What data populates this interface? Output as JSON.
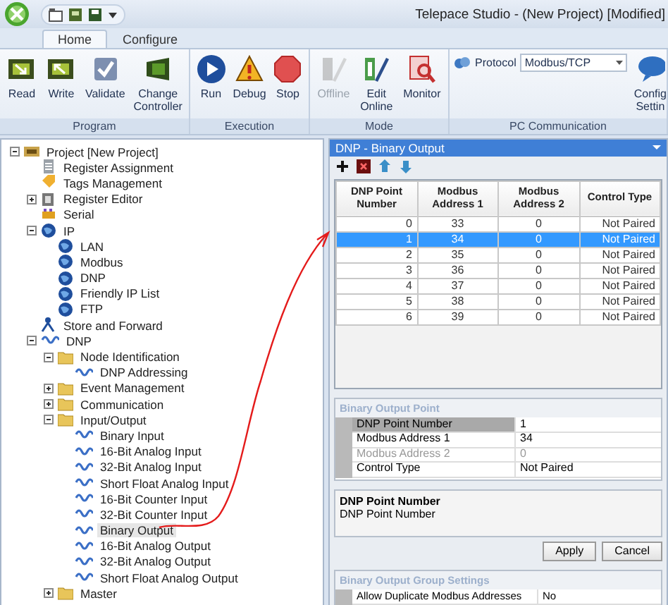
{
  "window": {
    "title": "Telepace Studio - (New Project) [Modified]"
  },
  "ribbon": {
    "tabs": [
      {
        "label": "Home",
        "selected": true
      },
      {
        "label": "Configure",
        "selected": false
      }
    ],
    "groups": [
      {
        "label": "Program",
        "buttons": [
          {
            "label": "Read",
            "disabled": false
          },
          {
            "label": "Write",
            "disabled": false
          },
          {
            "label": "Validate",
            "disabled": false
          },
          {
            "label": "Change\nController",
            "disabled": false
          }
        ]
      },
      {
        "label": "Execution",
        "buttons": [
          {
            "label": "Run",
            "disabled": false
          },
          {
            "label": "Debug",
            "disabled": false
          },
          {
            "label": "Stop",
            "disabled": false
          }
        ]
      },
      {
        "label": "Mode",
        "buttons": [
          {
            "label": "Offline",
            "disabled": true
          },
          {
            "label": "Edit\nOnline",
            "disabled": false
          },
          {
            "label": "Monitor",
            "disabled": false
          }
        ]
      },
      {
        "label": "PC Communication",
        "protocol": {
          "label": "Protocol",
          "value": "Modbus/TCP"
        },
        "buttons": [
          {
            "label": "Config\nSettin",
            "disabled": false
          }
        ]
      }
    ]
  },
  "tree": [
    {
      "label": "Project [New Project]",
      "kind": "project",
      "expanded": true,
      "selected": false,
      "children": [
        {
          "label": "Register Assignment",
          "kind": "doc",
          "selected": false
        },
        {
          "label": "Tags Management",
          "kind": "tag",
          "selected": false
        },
        {
          "label": "Register Editor",
          "kind": "editor",
          "expanded": false,
          "selected": false
        },
        {
          "label": "Serial",
          "kind": "serial",
          "selected": false
        },
        {
          "label": "IP",
          "kind": "globe",
          "expanded": true,
          "selected": false,
          "children": [
            {
              "label": "LAN",
              "kind": "globe",
              "selected": false
            },
            {
              "label": "Modbus",
              "kind": "globe",
              "selected": false
            },
            {
              "label": "DNP",
              "kind": "globe",
              "selected": false
            },
            {
              "label": "Friendly IP List",
              "kind": "globe",
              "selected": false
            },
            {
              "label": "FTP",
              "kind": "globe",
              "selected": false
            }
          ]
        },
        {
          "label": "Store and Forward",
          "kind": "flow",
          "selected": false
        },
        {
          "label": "DNP",
          "kind": "dnp",
          "expanded": true,
          "selected": false,
          "children": [
            {
              "label": "Node Identification",
              "kind": "folder",
              "expanded": true,
              "selected": false,
              "children": [
                {
                  "label": "DNP Addressing",
                  "kind": "dnp",
                  "selected": false
                }
              ]
            },
            {
              "label": "Event Management",
              "kind": "folder",
              "expanded": false,
              "selected": false
            },
            {
              "label": "Communication",
              "kind": "folder",
              "expanded": false,
              "selected": false
            },
            {
              "label": "Input/Output",
              "kind": "folder",
              "expanded": true,
              "selected": false,
              "children": [
                {
                  "label": "Binary Input",
                  "kind": "dnp",
                  "selected": false
                },
                {
                  "label": "16-Bit Analog Input",
                  "kind": "dnp",
                  "selected": false
                },
                {
                  "label": "32-Bit Analog Input",
                  "kind": "dnp",
                  "selected": false
                },
                {
                  "label": "Short Float Analog Input",
                  "kind": "dnp",
                  "selected": false
                },
                {
                  "label": "16-Bit Counter Input",
                  "kind": "dnp",
                  "selected": false
                },
                {
                  "label": "32-Bit Counter Input",
                  "kind": "dnp",
                  "selected": false
                },
                {
                  "label": "Binary Output",
                  "kind": "dnp",
                  "selected": true
                },
                {
                  "label": "16-Bit Analog Output",
                  "kind": "dnp",
                  "selected": false
                },
                {
                  "label": "32-Bit Analog Output",
                  "kind": "dnp",
                  "selected": false
                },
                {
                  "label": "Short Float Analog Output",
                  "kind": "dnp",
                  "selected": false
                }
              ]
            },
            {
              "label": "Master",
              "kind": "folder",
              "expanded": false,
              "selected": false
            }
          ]
        }
      ]
    }
  ],
  "editor": {
    "title": "DNP - Binary Output",
    "table": {
      "columns": [
        "DNP Point\nNumber",
        "Modbus\nAddress 1",
        "Modbus\nAddress 2",
        "Control Type"
      ],
      "rows": [
        {
          "cells": [
            "0",
            "33",
            "0",
            "Not Paired"
          ],
          "selected": false
        },
        {
          "cells": [
            "1",
            "34",
            "0",
            "Not Paired"
          ],
          "selected": true
        },
        {
          "cells": [
            "2",
            "35",
            "0",
            "Not Paired"
          ],
          "selected": false
        },
        {
          "cells": [
            "3",
            "36",
            "0",
            "Not Paired"
          ],
          "selected": false
        },
        {
          "cells": [
            "4",
            "37",
            "0",
            "Not Paired"
          ],
          "selected": false
        },
        {
          "cells": [
            "5",
            "38",
            "0",
            "Not Paired"
          ],
          "selected": false
        },
        {
          "cells": [
            "6",
            "39",
            "0",
            "Not Paired"
          ],
          "selected": false
        }
      ]
    },
    "point": {
      "title": "Binary Output Point",
      "properties": [
        {
          "label": "DNP Point Number",
          "value": "1",
          "selected": true,
          "disabled": false
        },
        {
          "label": "Modbus Address 1",
          "value": "34",
          "selected": false,
          "disabled": false
        },
        {
          "label": "Modbus Address 2",
          "value": "0",
          "selected": false,
          "disabled": true
        },
        {
          "label": "Control Type",
          "value": "Not Paired",
          "selected": false,
          "disabled": false
        }
      ]
    },
    "description": {
      "title": "DNP Point Number",
      "text": "DNP Point Number"
    },
    "buttons": [
      "Apply",
      "Cancel"
    ],
    "group_settings": {
      "title": "Binary Output Group Settings",
      "properties": [
        {
          "label": "Allow Duplicate Modbus Addresses",
          "value": "No"
        }
      ]
    }
  }
}
